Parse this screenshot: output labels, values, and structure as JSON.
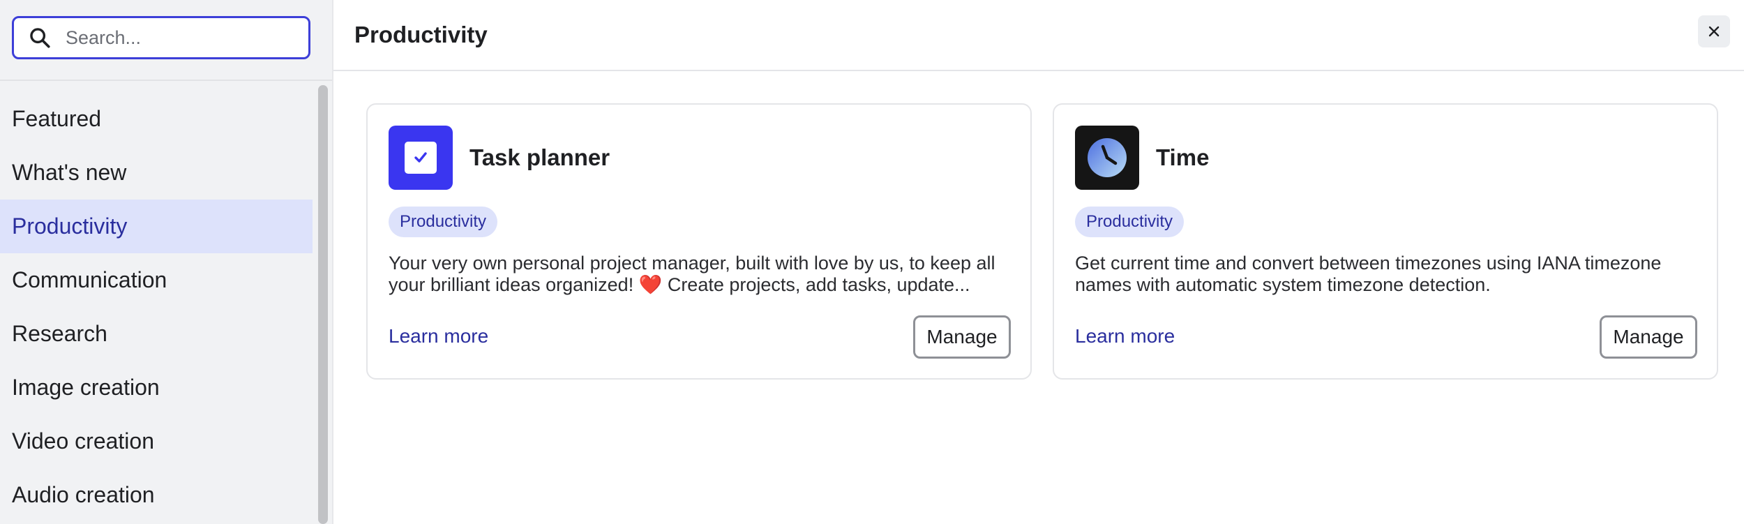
{
  "search": {
    "placeholder": "Search..."
  },
  "sidebar": {
    "items": [
      {
        "label": "Featured"
      },
      {
        "label": "What's new"
      },
      {
        "label": "Productivity",
        "active": true
      },
      {
        "label": "Communication"
      },
      {
        "label": "Research"
      },
      {
        "label": "Image creation"
      },
      {
        "label": "Video creation"
      },
      {
        "label": "Audio creation"
      }
    ]
  },
  "header": {
    "title": "Productivity",
    "close_icon": "close-icon"
  },
  "cards": [
    {
      "title": "Task planner",
      "icon": "checkbox-icon",
      "badge": "Productivity",
      "description": "Your very own personal project manager, built with love by us, to keep all your brilliant ideas organized! ❤️ Create projects, add tasks, update...",
      "learn_more": "Learn more",
      "manage": "Manage"
    },
    {
      "title": "Time",
      "icon": "clock-icon",
      "badge": "Productivity",
      "description": "Get current time and convert between timezones using IANA timezone names with automatic system timezone detection.",
      "learn_more": "Learn more",
      "manage": "Manage"
    }
  ],
  "colors": {
    "accent": "#3d3fd8",
    "active_bg": "#dde2fb",
    "link": "#2a2e9e",
    "task_icon_bg": "#3a36f0",
    "time_icon_bg": "#151515"
  }
}
